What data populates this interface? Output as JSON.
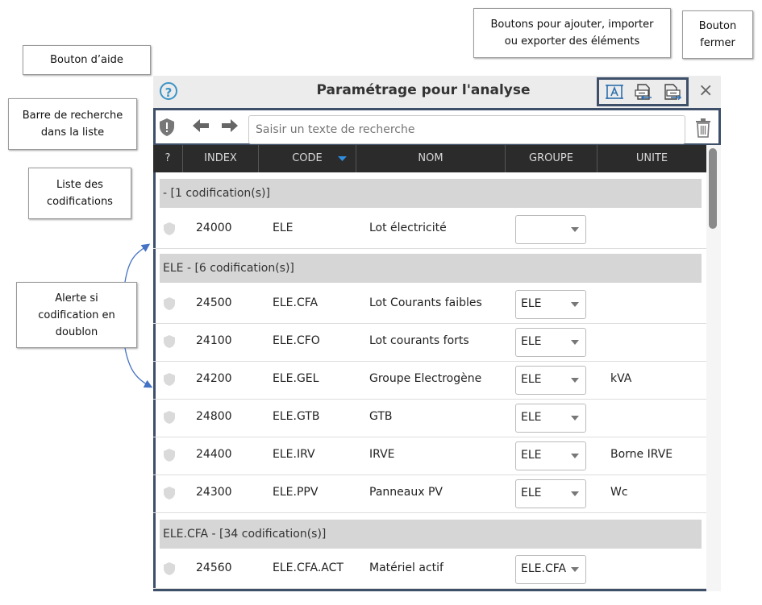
{
  "callouts": {
    "help": "Bouton d’aide",
    "search": "Barre de recherche\ndans la liste",
    "list": "Liste des\ncodifications",
    "alert": "Alerte si\ncodification en\ndoublon",
    "actions": "Boutons pour ajouter, importer\nou exporter des éléments",
    "close": "Bouton\nfermer"
  },
  "dialog": {
    "title": "Paramétrage pour l'analyse",
    "help_symbol": "?",
    "close_symbol": "×"
  },
  "search": {
    "placeholder": "Saisir un texte de recherche"
  },
  "columns": [
    "?",
    "INDEX",
    "CODE",
    "NOM",
    "GROUPE",
    "UNITE"
  ],
  "groups": [
    {
      "label": "- [1 codification(s)]",
      "rows": [
        {
          "index": "24000",
          "code": "ELE",
          "nom": "Lot électricité",
          "groupe": "",
          "unite": ""
        }
      ]
    },
    {
      "label": "ELE - [6 codification(s)]",
      "rows": [
        {
          "index": "24500",
          "code": "ELE.CFA",
          "nom": "Lot Courants faibles",
          "groupe": "ELE",
          "unite": ""
        },
        {
          "index": "24100",
          "code": "ELE.CFO",
          "nom": "Lot courants forts",
          "groupe": "ELE",
          "unite": ""
        },
        {
          "index": "24200",
          "code": "ELE.GEL",
          "nom": "Groupe Electrogène",
          "groupe": "ELE",
          "unite": "kVA"
        },
        {
          "index": "24800",
          "code": "ELE.GTB",
          "nom": "GTB",
          "groupe": "ELE",
          "unite": ""
        },
        {
          "index": "24400",
          "code": "ELE.IRV",
          "nom": "IRVE",
          "groupe": "ELE",
          "unite": "Borne IRVE"
        },
        {
          "index": "24300",
          "code": "ELE.PPV",
          "nom": "Panneaux PV",
          "groupe": "ELE",
          "unite": "Wc"
        }
      ]
    },
    {
      "label": "ELE.CFA - [34 codification(s)]",
      "rows": [
        {
          "index": "24560",
          "code": "ELE.CFA.ACT",
          "nom": "Matériel actif",
          "groupe": "ELE.CFA",
          "unite": ""
        }
      ]
    }
  ],
  "colors": {
    "frame": "#3e4f6a",
    "header_bg": "#2b2b2b",
    "help_accent": "#3d93c6"
  }
}
